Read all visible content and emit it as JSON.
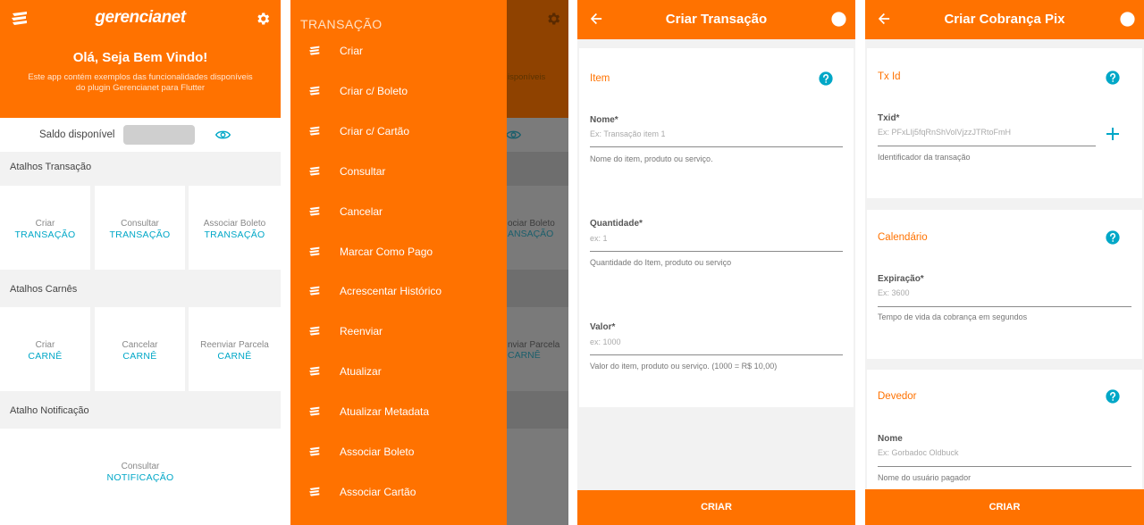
{
  "home": {
    "brand": "gerencianet",
    "welcome": "Olá, Seja Bem Vindo!",
    "description": "Este app contém exemplos das funcionalidades disponíveis do plugin Gerencianet para Flutter",
    "saldo_label": "Saldo disponível",
    "sections": [
      {
        "title": "Atalhos Transação",
        "tiles": [
          {
            "line1": "Criar",
            "line2": "TRANSAÇÃO"
          },
          {
            "line1": "Consultar",
            "line2": "TRANSAÇÃO"
          },
          {
            "line1": "Associar Boleto",
            "line2": "TRANSAÇÃO"
          }
        ]
      },
      {
        "title": "Atalhos Carnês",
        "tiles": [
          {
            "line1": "Criar",
            "line2": "CARNÊ"
          },
          {
            "line1": "Cancelar",
            "line2": "CARNÊ"
          },
          {
            "line1": "Reenviar Parcela",
            "line2": "CARNÊ"
          }
        ]
      },
      {
        "title": "Atalho Notificação",
        "tiles": [
          {
            "line1": "Consultar",
            "line2": "NOTIFICAÇÃO"
          }
        ]
      }
    ]
  },
  "drawer": {
    "title": "TRANSAÇÃO",
    "items": [
      "Criar",
      "Criar c/ Boleto",
      "Criar c/ Cartão",
      "Consultar",
      "Cancelar",
      "Marcar Como Pago",
      "Acrescentar Histórico",
      "Reenviar",
      "Atualizar",
      "Atualizar Metadata",
      "Associar Boleto",
      "Associar Cartão"
    ],
    "ghost": {
      "desc": "isponíveis",
      "tile_line1": "ociar Boleto",
      "tile_line2": "ANSAÇÃO",
      "tile2_line1": "nviar Parcela",
      "tile2_line2": "CARNÊ"
    }
  },
  "criar_transacao": {
    "title": "Criar Transação",
    "section": "Item",
    "fields": [
      {
        "label": "Nome*",
        "placeholder": "Ex: Transação item 1",
        "help": "Nome do item, produto ou serviço."
      },
      {
        "label": "Quantidade*",
        "placeholder": "ex: 1",
        "help": "Quantidade do Item, produto ou serviço"
      },
      {
        "label": "Valor*",
        "placeholder": "ex: 1000",
        "help": "Valor do item, produto ou serviço. (1000 = R$ 10,00)"
      }
    ],
    "button": "CRIAR"
  },
  "criar_pix": {
    "title": "Criar Cobrança Pix",
    "sections": [
      {
        "title": "Tx Id",
        "label": "Txid*",
        "placeholder": "Ex: PFxLIj5fqRnShVolVjzzJTRtoFmH",
        "help": "Identificador da transação"
      },
      {
        "title": "Calendário",
        "label": "Expiração*",
        "placeholder": "Ex: 3600",
        "help": "Tempo de vida da cobrança em segundos"
      },
      {
        "title": "Devedor",
        "label": "Nome",
        "placeholder": "Ex: Gorbadoc Oldbuck",
        "help": "Nome do usuário pagador"
      }
    ],
    "button": "CRIAR"
  },
  "colors": {
    "primary": "#ff7200",
    "accent": "#00a7c7",
    "background": "#f2f2f2"
  },
  "icons": [
    "gerencianet-logo-icon",
    "gear-icon",
    "eye-icon",
    "back-arrow-icon",
    "help-circle-icon",
    "plus-icon"
  ]
}
